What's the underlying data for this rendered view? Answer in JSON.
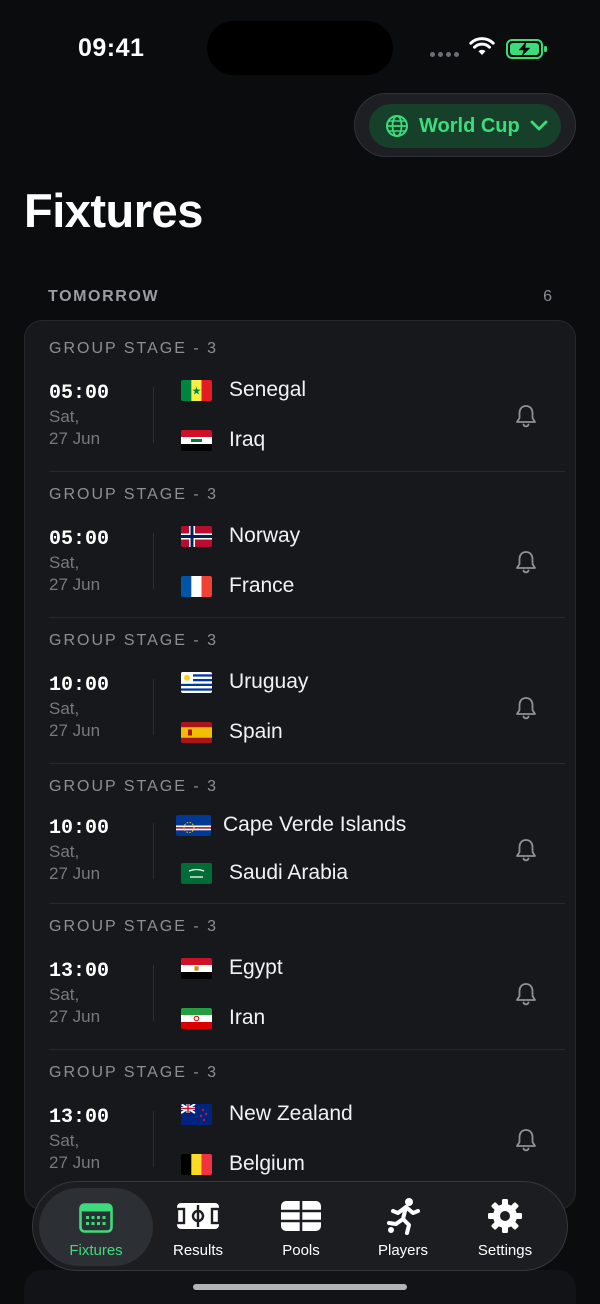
{
  "status": {
    "time": "09:41"
  },
  "competition": {
    "label": "World Cup"
  },
  "page": {
    "title": "Fixtures"
  },
  "section": {
    "label": "TOMORROW",
    "count": "6"
  },
  "matches": [
    {
      "stage": "GROUP STAGE - 3",
      "time": "05:00",
      "day": "Sat,",
      "date": "27 Jun",
      "home": "Senegal",
      "away": "Iraq"
    },
    {
      "stage": "GROUP STAGE - 3",
      "time": "05:00",
      "day": "Sat,",
      "date": "27 Jun",
      "home": "Norway",
      "away": "France"
    },
    {
      "stage": "GROUP STAGE - 3",
      "time": "10:00",
      "day": "Sat,",
      "date": "27 Jun",
      "home": "Uruguay",
      "away": "Spain"
    },
    {
      "stage": "GROUP STAGE - 3",
      "time": "10:00",
      "day": "Sat,",
      "date": "27 Jun",
      "home": "Cape Verde Islands",
      "away": "Saudi Arabia"
    },
    {
      "stage": "GROUP STAGE - 3",
      "time": "13:00",
      "day": "Sat,",
      "date": "27 Jun",
      "home": "Egypt",
      "away": "Iran"
    },
    {
      "stage": "GROUP STAGE - 3",
      "time": "13:00",
      "day": "Sat,",
      "date": "27 Jun",
      "home": "New Zealand",
      "away": "Belgium"
    }
  ],
  "tabs": [
    {
      "label": "Fixtures",
      "icon": "calendar-icon"
    },
    {
      "label": "Results",
      "icon": "pitch-icon"
    },
    {
      "label": "Pools",
      "icon": "table-icon"
    },
    {
      "label": "Players",
      "icon": "player-kick-icon"
    },
    {
      "label": "Settings",
      "icon": "gear-icon"
    }
  ],
  "colors": {
    "accent": "#3ddc7a",
    "background": "#0b0c0e",
    "card": "#17181b"
  }
}
